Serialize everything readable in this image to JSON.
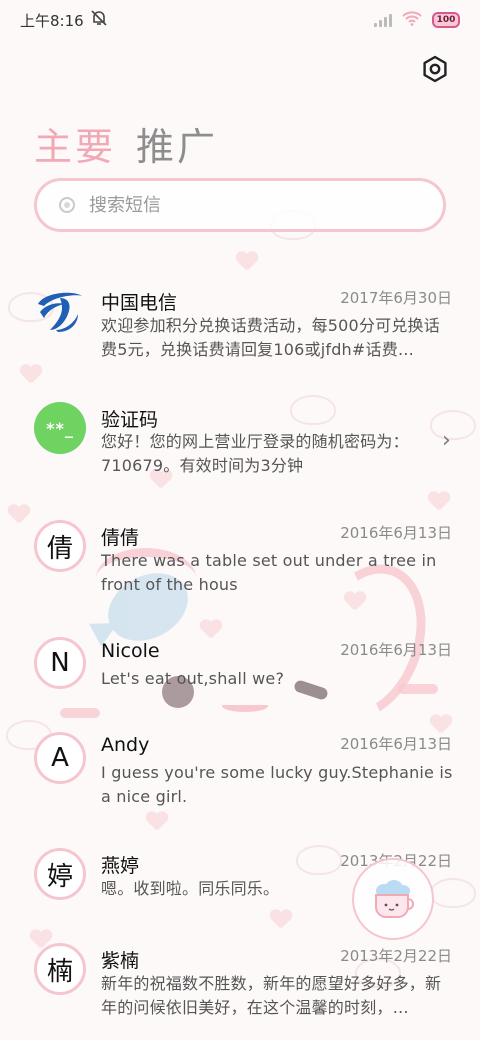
{
  "status_bar": {
    "time": "上午8:16",
    "battery": "100"
  },
  "tabs": [
    {
      "label": "主要",
      "active": true
    },
    {
      "label": "推广",
      "active": false
    }
  ],
  "search": {
    "placeholder": "搜索短信"
  },
  "messages": [
    {
      "avatar_type": "telecom-logo",
      "avatar_text": "",
      "name": "中国电信",
      "date": "2017年6月30日",
      "preview": "欢迎参加积分兑换话费活动，每500分可兑换话费5元，兑换话费请回复106或jfdh#话费…"
    },
    {
      "avatar_type": "green",
      "avatar_text": "**_",
      "name": "验证码",
      "date": "",
      "preview": "您好！您的网上营业厅登录的随机密码为：710679。有效时间为3分钟"
    },
    {
      "avatar_type": "letter",
      "avatar_text": "倩",
      "name": "倩倩",
      "date": "2016年6月13日",
      "preview": "There was a table set out under a tree in front of the hous"
    },
    {
      "avatar_type": "letter",
      "avatar_text": "N",
      "name": "Nicole",
      "date": "2016年6月13日",
      "preview": "Let's eat out,shall we?"
    },
    {
      "avatar_type": "letter",
      "avatar_text": "A",
      "name": "Andy",
      "date": "2016年6月13日",
      "preview": "I guess you're some lucky guy.Stephanie is a nice girl."
    },
    {
      "avatar_type": "letter",
      "avatar_text": "婷",
      "name": "燕婷",
      "date": "2013年2月22日",
      "preview": "嗯。收到啦。同乐同乐。"
    },
    {
      "avatar_type": "letter",
      "avatar_text": "楠",
      "name": "紫楠",
      "date": "2013年2月22日",
      "preview": "新年的祝福数不胜数，新年的愿望好多好多，新年的问候依旧美好，在这个温馨的时刻，…"
    }
  ],
  "colors": {
    "accent": "#f1a9b6",
    "avatar_border": "#f5c6d0",
    "green_avatar": "#6fd362",
    "telecom_blue": "#1f5fb4"
  },
  "icons": {
    "settings": "hexagon-gear-icon",
    "compose": "cup-compose-icon",
    "mute": "bell-muted-icon",
    "wifi": "wifi-icon",
    "signal": "signal-icon",
    "battery": "battery-icon",
    "chevron": "chevron-right-icon"
  }
}
